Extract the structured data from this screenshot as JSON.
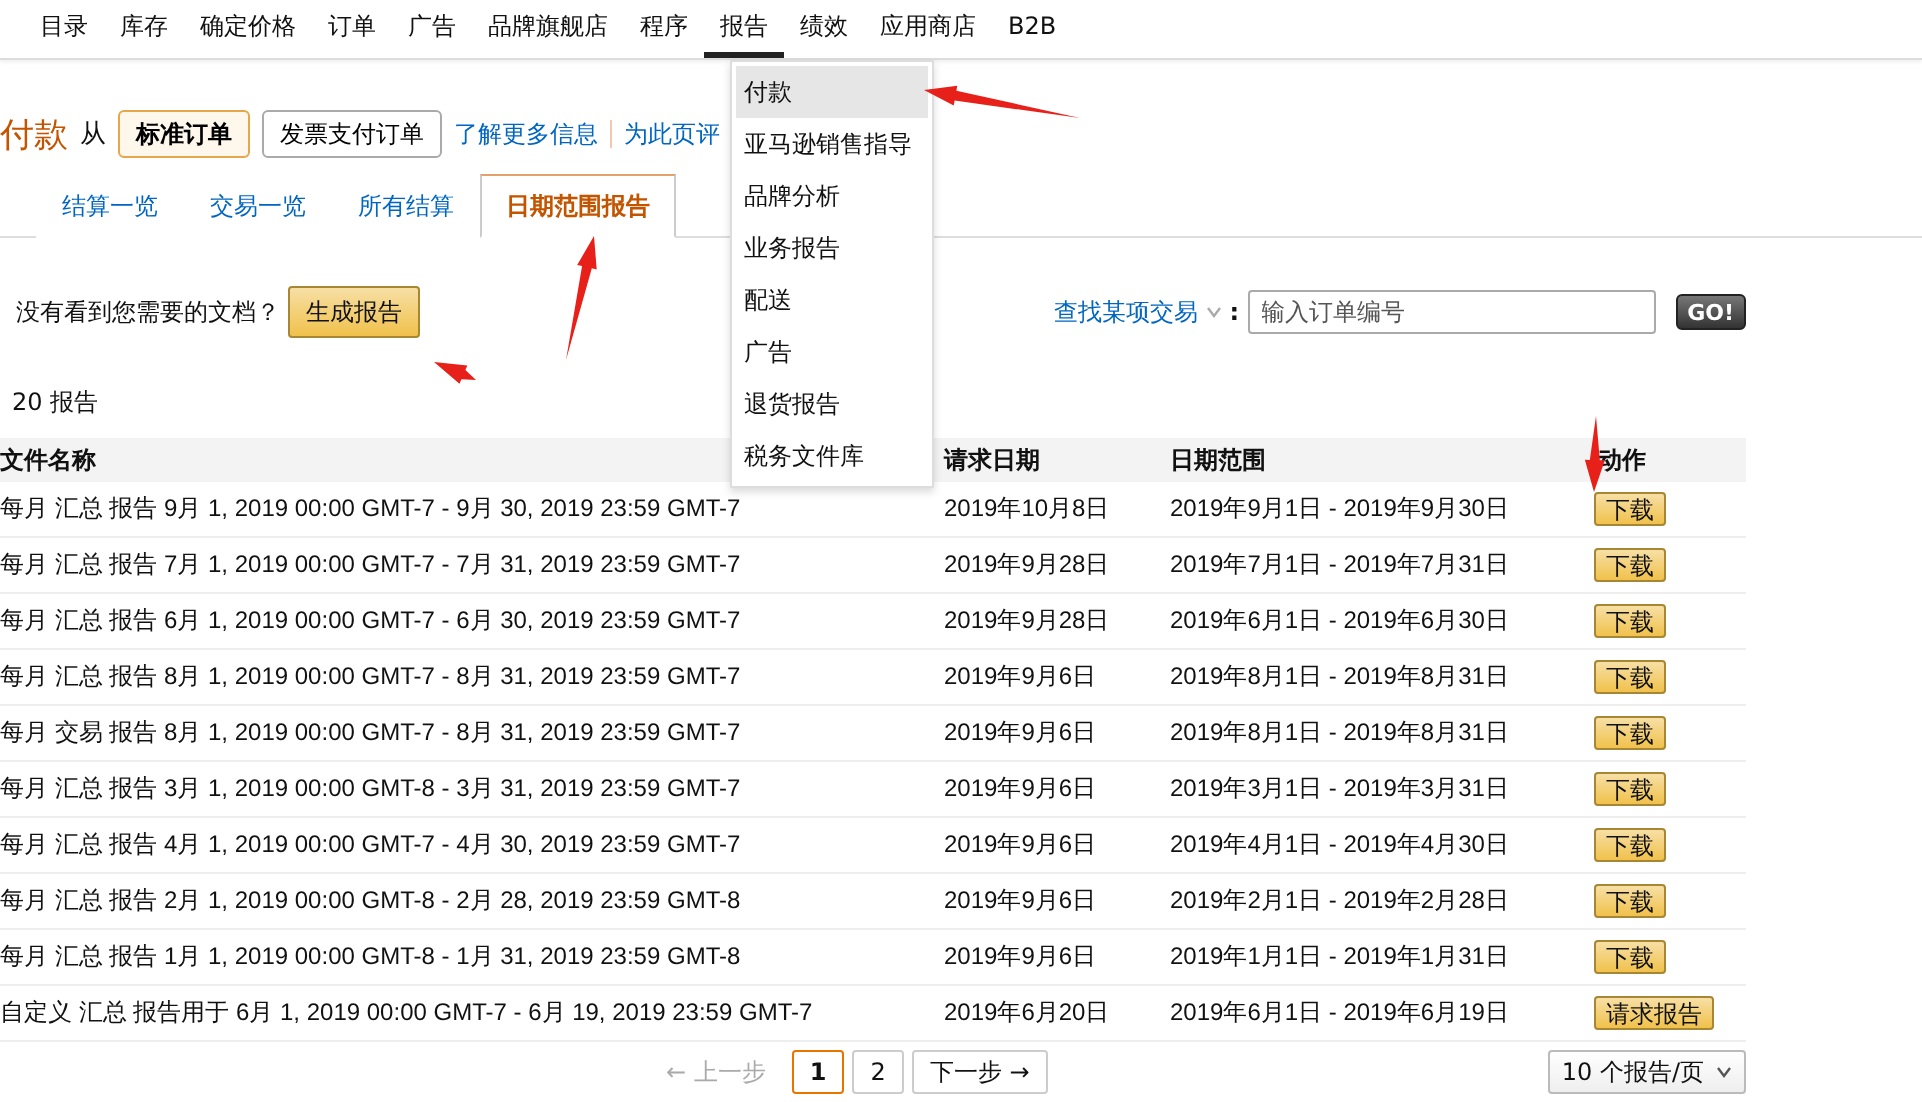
{
  "nav": {
    "items": [
      {
        "label": "目录",
        "selected": false
      },
      {
        "label": "库存",
        "selected": false
      },
      {
        "label": "确定价格",
        "selected": false
      },
      {
        "label": "订单",
        "selected": false
      },
      {
        "label": "广告",
        "selected": false
      },
      {
        "label": "品牌旗舰店",
        "selected": false
      },
      {
        "label": "程序",
        "selected": false
      },
      {
        "label": "报告",
        "selected": true
      },
      {
        "label": "绩效",
        "selected": false
      },
      {
        "label": "应用商店",
        "selected": false
      },
      {
        "label": "B2B",
        "selected": false
      }
    ]
  },
  "menu": {
    "items": [
      {
        "label": "付款",
        "selected": true
      },
      {
        "label": "亚马逊销售指导",
        "selected": false
      },
      {
        "label": "品牌分析",
        "selected": false
      },
      {
        "label": "业务报告",
        "selected": false
      },
      {
        "label": "配送",
        "selected": false
      },
      {
        "label": "广告",
        "selected": false
      },
      {
        "label": "退货报告",
        "selected": false
      },
      {
        "label": "税务文件库",
        "selected": false
      }
    ]
  },
  "header": {
    "title": "付款",
    "from_label": "从",
    "order_types": [
      {
        "label": "标准订单",
        "selected": true
      },
      {
        "label": "发票支付订单",
        "selected": false
      }
    ],
    "links": [
      "了解更多信息",
      "为此页评"
    ]
  },
  "tabs": [
    {
      "label": "结算一览",
      "selected": false
    },
    {
      "label": "交易一览",
      "selected": false
    },
    {
      "label": "所有结算",
      "selected": false
    },
    {
      "label": "日期范围报告",
      "selected": true
    }
  ],
  "prompt": {
    "text": "没有看到您需要的文档？",
    "button": "生成报告"
  },
  "search": {
    "label": "查找某项交易",
    "separator": ":",
    "placeholder": "输入订单编号",
    "button": "GO!"
  },
  "report_count": "20 报告",
  "table": {
    "columns": [
      "文件名称",
      "请求日期",
      "日期范围",
      "动作"
    ],
    "rows": [
      {
        "name": "每月 汇总 报告 9月 1, 2019 00:00 GMT-7 - 9月 30, 2019 23:59 GMT-7",
        "requested": "2019年10月8日",
        "range": "2019年9月1日 - 2019年9月30日",
        "action": "下载"
      },
      {
        "name": "每月 汇总 报告 7月 1, 2019 00:00 GMT-7 - 7月 31, 2019 23:59 GMT-7",
        "requested": "2019年9月28日",
        "range": "2019年7月1日 - 2019年7月31日",
        "action": "下载"
      },
      {
        "name": "每月 汇总 报告 6月 1, 2019 00:00 GMT-7 - 6月 30, 2019 23:59 GMT-7",
        "requested": "2019年9月28日",
        "range": "2019年6月1日 - 2019年6月30日",
        "action": "下载"
      },
      {
        "name": "每月 汇总 报告 8月 1, 2019 00:00 GMT-7 - 8月 31, 2019 23:59 GMT-7",
        "requested": "2019年9月6日",
        "range": "2019年8月1日 - 2019年8月31日",
        "action": "下载"
      },
      {
        "name": "每月 交易 报告 8月 1, 2019 00:00 GMT-7 - 8月 31, 2019 23:59 GMT-7",
        "requested": "2019年9月6日",
        "range": "2019年8月1日 - 2019年8月31日",
        "action": "下载"
      },
      {
        "name": "每月 汇总 报告 3月 1, 2019 00:00 GMT-8 - 3月 31, 2019 23:59 GMT-7",
        "requested": "2019年9月6日",
        "range": "2019年3月1日 - 2019年3月31日",
        "action": "下载"
      },
      {
        "name": "每月 汇总 报告 4月 1, 2019 00:00 GMT-7 - 4月 30, 2019 23:59 GMT-7",
        "requested": "2019年9月6日",
        "range": "2019年4月1日 - 2019年4月30日",
        "action": "下载"
      },
      {
        "name": "每月 汇总 报告 2月 1, 2019 00:00 GMT-8 - 2月 28, 2019 23:59 GMT-8",
        "requested": "2019年9月6日",
        "range": "2019年2月1日 - 2019年2月28日",
        "action": "下载"
      },
      {
        "name": "每月 汇总 报告 1月 1, 2019 00:00 GMT-8 - 1月 31, 2019 23:59 GMT-8",
        "requested": "2019年9月6日",
        "range": "2019年1月1日 - 2019年1月31日",
        "action": "下载"
      },
      {
        "name": "自定义 汇总 报告用于 6月 1, 2019 00:00 GMT-7 - 6月 19, 2019 23:59 GMT-7",
        "requested": "2019年6月20日",
        "range": "2019年6月1日 - 2019年6月19日",
        "action": "请求报告"
      }
    ]
  },
  "pagination": {
    "prev": {
      "label": "← 上一步",
      "disabled": true
    },
    "pages": [
      {
        "label": "1",
        "selected": true
      },
      {
        "label": "2",
        "selected": false
      }
    ],
    "next": "下一步 →",
    "per_page": "10 个报告/页"
  }
}
